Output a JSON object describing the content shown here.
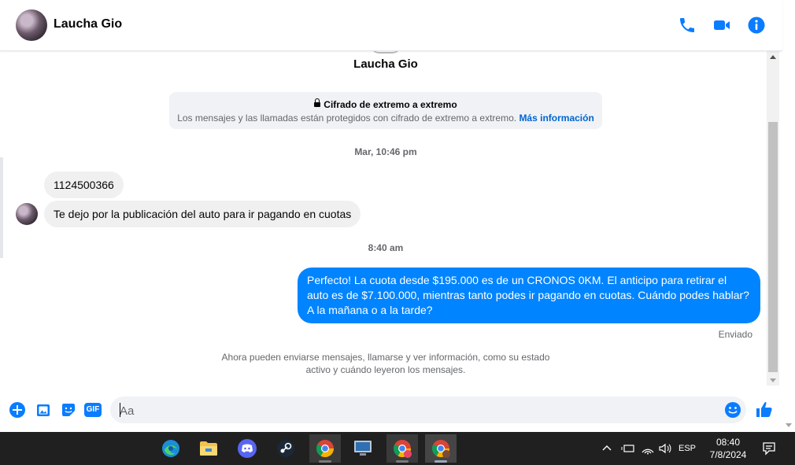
{
  "header": {
    "contact_name": "Laucha Gio"
  },
  "conversation": {
    "title": "Laucha Gio",
    "e2ee_title": "Cifrado de extremo a extremo",
    "e2ee_text": "Los mensajes y las llamadas están protegidos con cifrado de extremo a extremo.",
    "e2ee_link": "Más información",
    "timestamp1": "Mar, 10:46 pm",
    "incoming": [
      "1124500366",
      "Te dejo por la publicación del auto para ir pagando en cuotas"
    ],
    "timestamp2": "8:40 am",
    "outgoing": "Perfecto! La cuota desde $195.000 es de un CRONOS 0KM. El anticipo para retirar el auto es de $7.100.000, mientras tanto podes ir pagando en cuotas. Cuándo podes hablar? A la mañana o a la tarde?",
    "status": "Enviado",
    "info_note": "Ahora pueden enviarse mensajes, llamarse y ver información, como su estado activo y cuándo leyeron los mensajes."
  },
  "composer": {
    "placeholder": "Aa",
    "gif_label": "GIF"
  },
  "colors": {
    "messenger_blue": "#0084ff",
    "icon_blue": "#0a7cff",
    "taskbar": "#202020"
  },
  "taskbar": {
    "apps": [
      "edge-icon",
      "file-explorer-icon",
      "discord-icon",
      "steam-icon",
      "chrome-icon",
      "monitor-app-icon",
      "chrome-profile-icon",
      "chrome-profile-icon"
    ],
    "language": "ESP",
    "time": "08:40",
    "date": "7/8/2024"
  }
}
